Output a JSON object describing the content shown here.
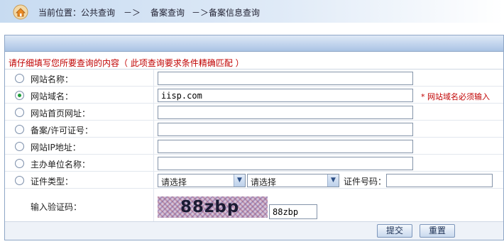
{
  "breadcrumb": {
    "icon": "home-icon",
    "current_label": "当前位置：公共查询",
    "sep1": "－＞",
    "item2": "备案查询",
    "sep2": "－＞备案信息查询"
  },
  "notice": "请仔细填写您所要查询的内容（ 此项查询要求条件精确匹配 ）",
  "fields": [
    {
      "label": "网站名称：",
      "selected": false,
      "value": ""
    },
    {
      "label": "网站域名：",
      "selected": true,
      "value": "iisp.com",
      "hint": "* 网站域名必须输入"
    },
    {
      "label": "网站首页网址：",
      "selected": false,
      "value": ""
    },
    {
      "label": "备案/许可证号：",
      "selected": false,
      "value": ""
    },
    {
      "label": "网站IP地址：",
      "selected": false,
      "value": ""
    },
    {
      "label": "主办单位名称：",
      "selected": false,
      "value": ""
    }
  ],
  "cert": {
    "label": "证件类型：",
    "select1": "请选择",
    "select2": "请选择",
    "number_label": "证件号码：",
    "number_value": ""
  },
  "captcha": {
    "label": "输入验证码：",
    "image_text": "88zbp",
    "input_value": "88zbp"
  },
  "buttons": {
    "submit": "提交",
    "reset": "重置"
  },
  "colors": {
    "notice_red": "#c00000",
    "panel_border": "#8ea6c6",
    "radio_selected": "#1f9e3a"
  }
}
